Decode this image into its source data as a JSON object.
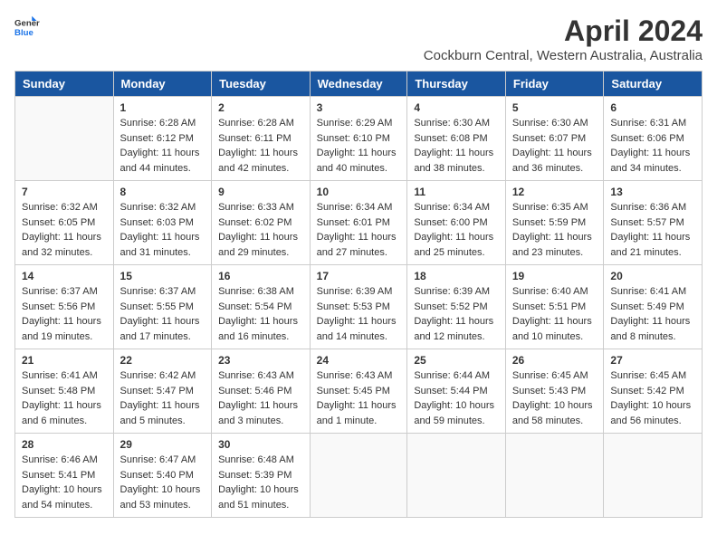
{
  "header": {
    "logo_line1": "General",
    "logo_line2": "Blue",
    "month_title": "April 2024",
    "location": "Cockburn Central, Western Australia, Australia"
  },
  "weekdays": [
    "Sunday",
    "Monday",
    "Tuesday",
    "Wednesday",
    "Thursday",
    "Friday",
    "Saturday"
  ],
  "weeks": [
    [
      {
        "day": "",
        "info": ""
      },
      {
        "day": "1",
        "info": "Sunrise: 6:28 AM\nSunset: 6:12 PM\nDaylight: 11 hours\nand 44 minutes."
      },
      {
        "day": "2",
        "info": "Sunrise: 6:28 AM\nSunset: 6:11 PM\nDaylight: 11 hours\nand 42 minutes."
      },
      {
        "day": "3",
        "info": "Sunrise: 6:29 AM\nSunset: 6:10 PM\nDaylight: 11 hours\nand 40 minutes."
      },
      {
        "day": "4",
        "info": "Sunrise: 6:30 AM\nSunset: 6:08 PM\nDaylight: 11 hours\nand 38 minutes."
      },
      {
        "day": "5",
        "info": "Sunrise: 6:30 AM\nSunset: 6:07 PM\nDaylight: 11 hours\nand 36 minutes."
      },
      {
        "day": "6",
        "info": "Sunrise: 6:31 AM\nSunset: 6:06 PM\nDaylight: 11 hours\nand 34 minutes."
      }
    ],
    [
      {
        "day": "7",
        "info": "Sunrise: 6:32 AM\nSunset: 6:05 PM\nDaylight: 11 hours\nand 32 minutes."
      },
      {
        "day": "8",
        "info": "Sunrise: 6:32 AM\nSunset: 6:03 PM\nDaylight: 11 hours\nand 31 minutes."
      },
      {
        "day": "9",
        "info": "Sunrise: 6:33 AM\nSunset: 6:02 PM\nDaylight: 11 hours\nand 29 minutes."
      },
      {
        "day": "10",
        "info": "Sunrise: 6:34 AM\nSunset: 6:01 PM\nDaylight: 11 hours\nand 27 minutes."
      },
      {
        "day": "11",
        "info": "Sunrise: 6:34 AM\nSunset: 6:00 PM\nDaylight: 11 hours\nand 25 minutes."
      },
      {
        "day": "12",
        "info": "Sunrise: 6:35 AM\nSunset: 5:59 PM\nDaylight: 11 hours\nand 23 minutes."
      },
      {
        "day": "13",
        "info": "Sunrise: 6:36 AM\nSunset: 5:57 PM\nDaylight: 11 hours\nand 21 minutes."
      }
    ],
    [
      {
        "day": "14",
        "info": "Sunrise: 6:37 AM\nSunset: 5:56 PM\nDaylight: 11 hours\nand 19 minutes."
      },
      {
        "day": "15",
        "info": "Sunrise: 6:37 AM\nSunset: 5:55 PM\nDaylight: 11 hours\nand 17 minutes."
      },
      {
        "day": "16",
        "info": "Sunrise: 6:38 AM\nSunset: 5:54 PM\nDaylight: 11 hours\nand 16 minutes."
      },
      {
        "day": "17",
        "info": "Sunrise: 6:39 AM\nSunset: 5:53 PM\nDaylight: 11 hours\nand 14 minutes."
      },
      {
        "day": "18",
        "info": "Sunrise: 6:39 AM\nSunset: 5:52 PM\nDaylight: 11 hours\nand 12 minutes."
      },
      {
        "day": "19",
        "info": "Sunrise: 6:40 AM\nSunset: 5:51 PM\nDaylight: 11 hours\nand 10 minutes."
      },
      {
        "day": "20",
        "info": "Sunrise: 6:41 AM\nSunset: 5:49 PM\nDaylight: 11 hours\nand 8 minutes."
      }
    ],
    [
      {
        "day": "21",
        "info": "Sunrise: 6:41 AM\nSunset: 5:48 PM\nDaylight: 11 hours\nand 6 minutes."
      },
      {
        "day": "22",
        "info": "Sunrise: 6:42 AM\nSunset: 5:47 PM\nDaylight: 11 hours\nand 5 minutes."
      },
      {
        "day": "23",
        "info": "Sunrise: 6:43 AM\nSunset: 5:46 PM\nDaylight: 11 hours\nand 3 minutes."
      },
      {
        "day": "24",
        "info": "Sunrise: 6:43 AM\nSunset: 5:45 PM\nDaylight: 11 hours\nand 1 minute."
      },
      {
        "day": "25",
        "info": "Sunrise: 6:44 AM\nSunset: 5:44 PM\nDaylight: 10 hours\nand 59 minutes."
      },
      {
        "day": "26",
        "info": "Sunrise: 6:45 AM\nSunset: 5:43 PM\nDaylight: 10 hours\nand 58 minutes."
      },
      {
        "day": "27",
        "info": "Sunrise: 6:45 AM\nSunset: 5:42 PM\nDaylight: 10 hours\nand 56 minutes."
      }
    ],
    [
      {
        "day": "28",
        "info": "Sunrise: 6:46 AM\nSunset: 5:41 PM\nDaylight: 10 hours\nand 54 minutes."
      },
      {
        "day": "29",
        "info": "Sunrise: 6:47 AM\nSunset: 5:40 PM\nDaylight: 10 hours\nand 53 minutes."
      },
      {
        "day": "30",
        "info": "Sunrise: 6:48 AM\nSunset: 5:39 PM\nDaylight: 10 hours\nand 51 minutes."
      },
      {
        "day": "",
        "info": ""
      },
      {
        "day": "",
        "info": ""
      },
      {
        "day": "",
        "info": ""
      },
      {
        "day": "",
        "info": ""
      }
    ]
  ]
}
